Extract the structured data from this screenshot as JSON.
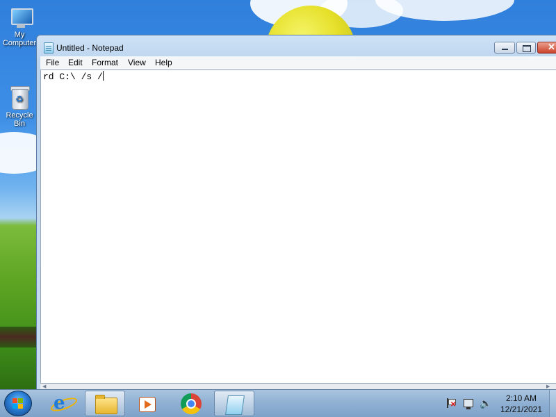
{
  "desktop": {
    "icons": [
      {
        "label": "My Computer",
        "icon": "computer-icon"
      },
      {
        "label": "Recycle Bin",
        "icon": "recycle-bin-icon"
      }
    ]
  },
  "window": {
    "title": "Untitled - Notepad",
    "app_icon": "notepad-icon",
    "menu": [
      "File",
      "Edit",
      "Format",
      "View",
      "Help"
    ],
    "content": "rd C:\\ /s /"
  },
  "taskbar": {
    "start_icon": "windows-start-icon",
    "apps": [
      {
        "name": "Internet Explorer",
        "icon": "internet-explorer-icon",
        "active": false
      },
      {
        "name": "Windows Explorer",
        "icon": "folder-icon",
        "active": true
      },
      {
        "name": "Windows Media Player",
        "icon": "media-player-icon",
        "active": false
      },
      {
        "name": "Google Chrome",
        "icon": "chrome-icon",
        "active": false
      },
      {
        "name": "Notepad",
        "icon": "notepad-icon",
        "active": true
      }
    ],
    "tray": {
      "icons": [
        "action-center-flag-icon",
        "network-icon",
        "volume-icon"
      ],
      "time": "2:10 AM",
      "date": "12/21/2021"
    }
  }
}
